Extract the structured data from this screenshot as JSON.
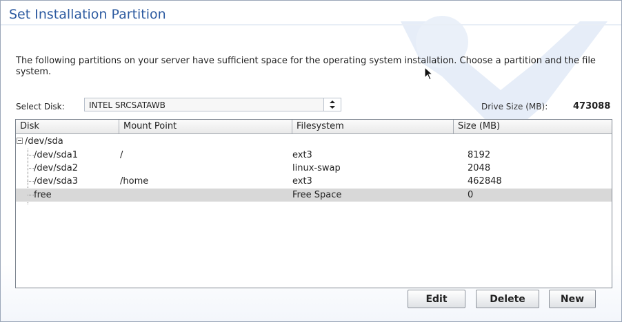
{
  "page": {
    "title": "Set Installation Partition",
    "description": "The following partitions on your server have sufficient space for the operating system installation. Choose a partition and the file system."
  },
  "disk_select": {
    "label": "Select Disk:",
    "value": "INTEL SRCSATAWB"
  },
  "drive_size": {
    "label": "Drive Size (MB):",
    "value": "473088"
  },
  "table": {
    "columns": [
      "Disk",
      "Mount Point",
      "Filesystem",
      "Size (MB)"
    ],
    "root": "/dev/sda",
    "rows": [
      {
        "disk": "/dev/sda1",
        "mount": "/",
        "filesystem": "ext3",
        "size": "8192"
      },
      {
        "disk": "/dev/sda2",
        "mount": "",
        "filesystem": "linux-swap",
        "size": "2048"
      },
      {
        "disk": "/dev/sda3",
        "mount": "/home",
        "filesystem": "ext3",
        "size": "462848"
      },
      {
        "disk": "free",
        "mount": "",
        "filesystem": "Free Space",
        "size": "0"
      }
    ],
    "selected_row": "free"
  },
  "buttons": {
    "edit": "Edit",
    "delete": "Delete",
    "new": "New"
  },
  "colors": {
    "title": "#2c5aa0",
    "selection": "#d8d8d8"
  },
  "icons": {
    "watermark": "wrench-icon",
    "select_arrows": "spinner-arrows-icon",
    "expander": "tree-collapse-icon",
    "cursor": "mouse-pointer-icon"
  }
}
